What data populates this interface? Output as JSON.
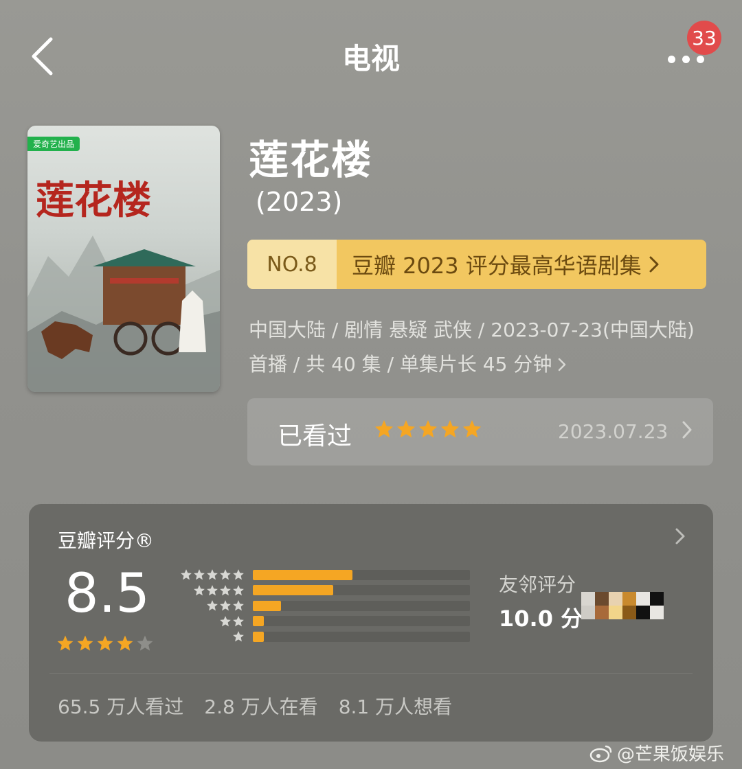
{
  "header": {
    "title": "电视",
    "badge_count": "33"
  },
  "poster": {
    "platform_badge": "爱奇艺出品",
    "calligraphy_title": "莲花楼"
  },
  "show": {
    "title": "莲花楼",
    "year": "(2023)"
  },
  "rank_banner": {
    "rank": "NO.8",
    "text": "豆瓣 2023 评分最高华语剧集"
  },
  "meta": {
    "line": "中国大陆 / 剧情 悬疑 武侠 / 2023-07-23(中国大陆) 首播 / 共 40 集 / 单集片长 45 分钟"
  },
  "watched": {
    "label": "已看过",
    "user_stars": 5,
    "date": "2023.07.23"
  },
  "rating": {
    "title": "豆瓣评分®",
    "score": "8.5",
    "star_rating": 4,
    "distribution": [
      {
        "stars": 5,
        "fraction": 0.46
      },
      {
        "stars": 4,
        "fraction": 0.37
      },
      {
        "stars": 3,
        "fraction": 0.13
      },
      {
        "stars": 2,
        "fraction": 0.05
      },
      {
        "stars": 1,
        "fraction": 0.05
      }
    ],
    "neighbor_label": "友邻评分",
    "neighbor_score": "10.0 分",
    "counts": [
      "65.5 万人看过",
      "2.8 万人在看",
      "8.1 万人想看"
    ]
  },
  "watermark": {
    "text": "@芒果饭娱乐",
    "icon": "weibo-icon"
  },
  "colors": {
    "star": "#f5a623",
    "banner": "#f2c760",
    "badge": "#e14b4b"
  }
}
